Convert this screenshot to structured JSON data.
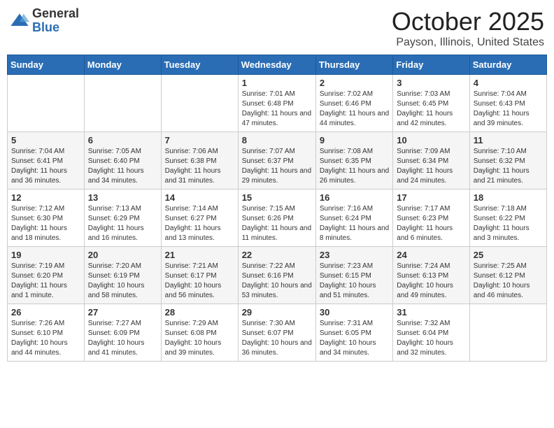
{
  "logo": {
    "general": "General",
    "blue": "Blue"
  },
  "header": {
    "month": "October 2025",
    "location": "Payson, Illinois, United States"
  },
  "weekdays": [
    "Sunday",
    "Monday",
    "Tuesday",
    "Wednesday",
    "Thursday",
    "Friday",
    "Saturday"
  ],
  "weeks": [
    [
      {
        "day": "",
        "info": ""
      },
      {
        "day": "",
        "info": ""
      },
      {
        "day": "",
        "info": ""
      },
      {
        "day": "1",
        "info": "Sunrise: 7:01 AM\nSunset: 6:48 PM\nDaylight: 11 hours and 47 minutes."
      },
      {
        "day": "2",
        "info": "Sunrise: 7:02 AM\nSunset: 6:46 PM\nDaylight: 11 hours and 44 minutes."
      },
      {
        "day": "3",
        "info": "Sunrise: 7:03 AM\nSunset: 6:45 PM\nDaylight: 11 hours and 42 minutes."
      },
      {
        "day": "4",
        "info": "Sunrise: 7:04 AM\nSunset: 6:43 PM\nDaylight: 11 hours and 39 minutes."
      }
    ],
    [
      {
        "day": "5",
        "info": "Sunrise: 7:04 AM\nSunset: 6:41 PM\nDaylight: 11 hours and 36 minutes."
      },
      {
        "day": "6",
        "info": "Sunrise: 7:05 AM\nSunset: 6:40 PM\nDaylight: 11 hours and 34 minutes."
      },
      {
        "day": "7",
        "info": "Sunrise: 7:06 AM\nSunset: 6:38 PM\nDaylight: 11 hours and 31 minutes."
      },
      {
        "day": "8",
        "info": "Sunrise: 7:07 AM\nSunset: 6:37 PM\nDaylight: 11 hours and 29 minutes."
      },
      {
        "day": "9",
        "info": "Sunrise: 7:08 AM\nSunset: 6:35 PM\nDaylight: 11 hours and 26 minutes."
      },
      {
        "day": "10",
        "info": "Sunrise: 7:09 AM\nSunset: 6:34 PM\nDaylight: 11 hours and 24 minutes."
      },
      {
        "day": "11",
        "info": "Sunrise: 7:10 AM\nSunset: 6:32 PM\nDaylight: 11 hours and 21 minutes."
      }
    ],
    [
      {
        "day": "12",
        "info": "Sunrise: 7:12 AM\nSunset: 6:30 PM\nDaylight: 11 hours and 18 minutes."
      },
      {
        "day": "13",
        "info": "Sunrise: 7:13 AM\nSunset: 6:29 PM\nDaylight: 11 hours and 16 minutes."
      },
      {
        "day": "14",
        "info": "Sunrise: 7:14 AM\nSunset: 6:27 PM\nDaylight: 11 hours and 13 minutes."
      },
      {
        "day": "15",
        "info": "Sunrise: 7:15 AM\nSunset: 6:26 PM\nDaylight: 11 hours and 11 minutes."
      },
      {
        "day": "16",
        "info": "Sunrise: 7:16 AM\nSunset: 6:24 PM\nDaylight: 11 hours and 8 minutes."
      },
      {
        "day": "17",
        "info": "Sunrise: 7:17 AM\nSunset: 6:23 PM\nDaylight: 11 hours and 6 minutes."
      },
      {
        "day": "18",
        "info": "Sunrise: 7:18 AM\nSunset: 6:22 PM\nDaylight: 11 hours and 3 minutes."
      }
    ],
    [
      {
        "day": "19",
        "info": "Sunrise: 7:19 AM\nSunset: 6:20 PM\nDaylight: 11 hours and 1 minute."
      },
      {
        "day": "20",
        "info": "Sunrise: 7:20 AM\nSunset: 6:19 PM\nDaylight: 10 hours and 58 minutes."
      },
      {
        "day": "21",
        "info": "Sunrise: 7:21 AM\nSunset: 6:17 PM\nDaylight: 10 hours and 56 minutes."
      },
      {
        "day": "22",
        "info": "Sunrise: 7:22 AM\nSunset: 6:16 PM\nDaylight: 10 hours and 53 minutes."
      },
      {
        "day": "23",
        "info": "Sunrise: 7:23 AM\nSunset: 6:15 PM\nDaylight: 10 hours and 51 minutes."
      },
      {
        "day": "24",
        "info": "Sunrise: 7:24 AM\nSunset: 6:13 PM\nDaylight: 10 hours and 49 minutes."
      },
      {
        "day": "25",
        "info": "Sunrise: 7:25 AM\nSunset: 6:12 PM\nDaylight: 10 hours and 46 minutes."
      }
    ],
    [
      {
        "day": "26",
        "info": "Sunrise: 7:26 AM\nSunset: 6:10 PM\nDaylight: 10 hours and 44 minutes."
      },
      {
        "day": "27",
        "info": "Sunrise: 7:27 AM\nSunset: 6:09 PM\nDaylight: 10 hours and 41 minutes."
      },
      {
        "day": "28",
        "info": "Sunrise: 7:29 AM\nSunset: 6:08 PM\nDaylight: 10 hours and 39 minutes."
      },
      {
        "day": "29",
        "info": "Sunrise: 7:30 AM\nSunset: 6:07 PM\nDaylight: 10 hours and 36 minutes."
      },
      {
        "day": "30",
        "info": "Sunrise: 7:31 AM\nSunset: 6:05 PM\nDaylight: 10 hours and 34 minutes."
      },
      {
        "day": "31",
        "info": "Sunrise: 7:32 AM\nSunset: 6:04 PM\nDaylight: 10 hours and 32 minutes."
      },
      {
        "day": "",
        "info": ""
      }
    ]
  ]
}
